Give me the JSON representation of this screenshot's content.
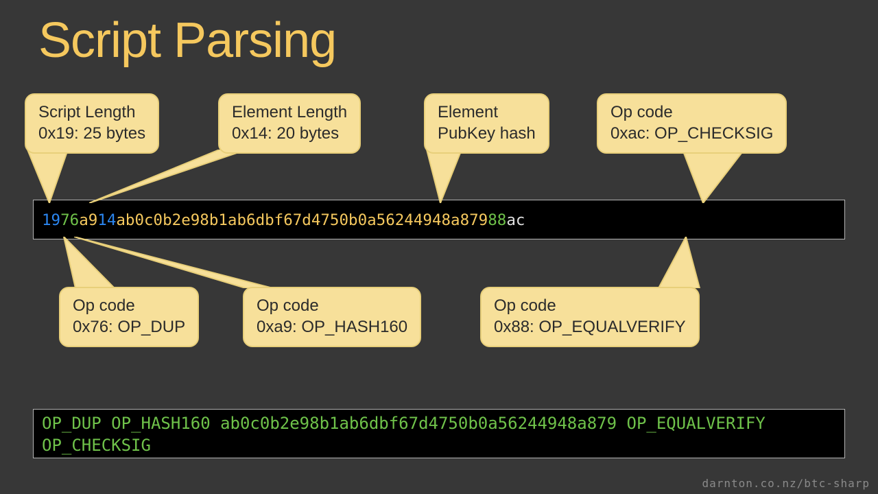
{
  "title": "Script Parsing",
  "callouts": {
    "script_length": {
      "line1": "Script Length",
      "line2": "0x19: 25 bytes"
    },
    "element_length": {
      "line1": "Element Length",
      "line2": "0x14: 20 bytes"
    },
    "element": {
      "line1": "Element",
      "line2": "PubKey hash"
    },
    "op_checksig": {
      "line1": "Op code",
      "line2": "0xac: OP_CHECKSIG"
    },
    "op_dup": {
      "line1": "Op code",
      "line2": "0x76: OP_DUP"
    },
    "op_hash160": {
      "line1": "Op code",
      "line2": "0xa9: OP_HASH160"
    },
    "op_equalverify": {
      "line1": "Op code",
      "line2": "0x88: OP_EQUALVERIFY"
    }
  },
  "hex": {
    "seg0": "19",
    "seg1": "76",
    "seg2": "a9",
    "seg3": "14",
    "seg4": "ab0c0b2e98b1ab6dbf67d4750b0a56244948a879",
    "seg5": "88",
    "seg6": "ac"
  },
  "script_text": "OP_DUP OP_HASH160 ab0c0b2e98b1ab6dbf67d4750b0a56244948a879 OP_EQUALVERIFY OP_CHECKSIG",
  "footer": "darnton.co.nz/btc-sharp"
}
